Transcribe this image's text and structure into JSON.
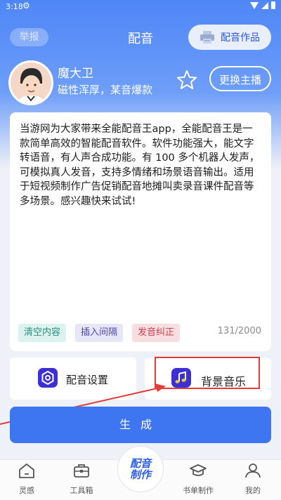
{
  "status_bar": {
    "time": "3:18"
  },
  "header": {
    "report_label": "举报",
    "title": "配音",
    "works_label": "配音作品"
  },
  "voice": {
    "name": "魔大卫",
    "description": "磁性浑厚，某音爆款",
    "change_label": "更换主播"
  },
  "editor": {
    "text": "当游网为大家带来全能配音王app，全能配音王是一款简单高效的智能配音软件。软件功能强大，能文字转语音，有人声合成功能。有 100 多个机器人发声，可模拟真人发音，支持多情绪和场景语音输出。适用于短视频制作广告促销配音地摊叫卖录音课件配音等多场景。感兴趣快来试试!",
    "chips": {
      "clear": "清空内容",
      "interval": "插入间隔",
      "fix": "发音纠正"
    },
    "char_count": "131/2000"
  },
  "options": {
    "settings_label": "配音设置",
    "music_label": "背景音乐"
  },
  "generate_label": "生成",
  "bottom_nav": {
    "inspiration": "灵感",
    "toolbox": "工具箱",
    "center_line1": "配音",
    "center_line2": "制作",
    "book": "书单制作",
    "mine": "我的"
  },
  "colors": {
    "primary": "#3e76f2",
    "header_gradient": "#4f86f7",
    "icon_purple": "#3c2fd6",
    "annotation_red": "#e53a3a"
  }
}
